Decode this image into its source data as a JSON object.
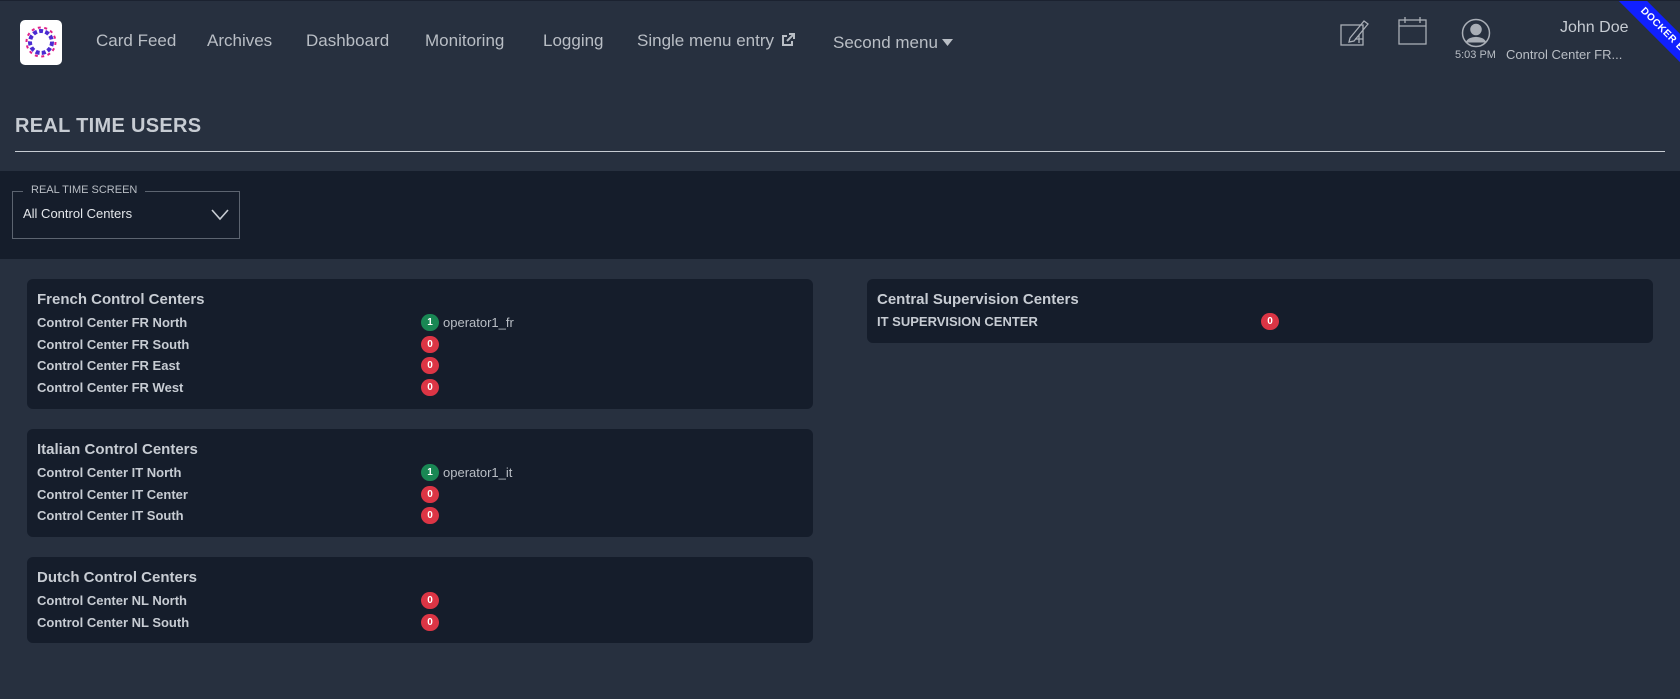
{
  "nav": {
    "items": [
      {
        "label": "Card Feed"
      },
      {
        "label": "Archives"
      },
      {
        "label": "Dashboard"
      },
      {
        "label": "Monitoring"
      },
      {
        "label": "Logging"
      },
      {
        "label": "Single menu entry"
      },
      {
        "label": "Second menu"
      }
    ],
    "user": {
      "time": "5:03 PM",
      "name": "John Doe",
      "entity": "Control Center FR..."
    },
    "ribbon": "DOCKER ENV"
  },
  "page": {
    "title": "REAL TIME USERS"
  },
  "filter": {
    "legend": "REAL TIME SCREEN",
    "selected": "All Control Centers"
  },
  "groups": {
    "french": {
      "title": "French Control Centers",
      "rows": [
        {
          "name": "Control Center FR North",
          "count": "1",
          "users": "operator1_fr"
        },
        {
          "name": "Control Center FR South",
          "count": "0",
          "users": ""
        },
        {
          "name": "Control Center FR East",
          "count": "0",
          "users": ""
        },
        {
          "name": "Control Center FR West",
          "count": "0",
          "users": ""
        }
      ]
    },
    "italian": {
      "title": "Italian Control Centers",
      "rows": [
        {
          "name": "Control Center IT North",
          "count": "1",
          "users": "operator1_it"
        },
        {
          "name": "Control Center IT Center",
          "count": "0",
          "users": ""
        },
        {
          "name": "Control Center IT South",
          "count": "0",
          "users": ""
        }
      ]
    },
    "dutch": {
      "title": "Dutch Control Centers",
      "rows": [
        {
          "name": "Control Center NL North",
          "count": "0",
          "users": ""
        },
        {
          "name": "Control Center NL South",
          "count": "0",
          "users": ""
        }
      ]
    },
    "central": {
      "title": "Central Supervision Centers",
      "rows": [
        {
          "name": "IT SUPERVISION CENTER",
          "count": "0",
          "users": ""
        }
      ]
    }
  },
  "colors": {
    "background": "#27303f",
    "panel": "#151d2b",
    "badge_zero": "#dc3545",
    "badge_connected": "#198754",
    "ribbon": "#1020ff"
  }
}
